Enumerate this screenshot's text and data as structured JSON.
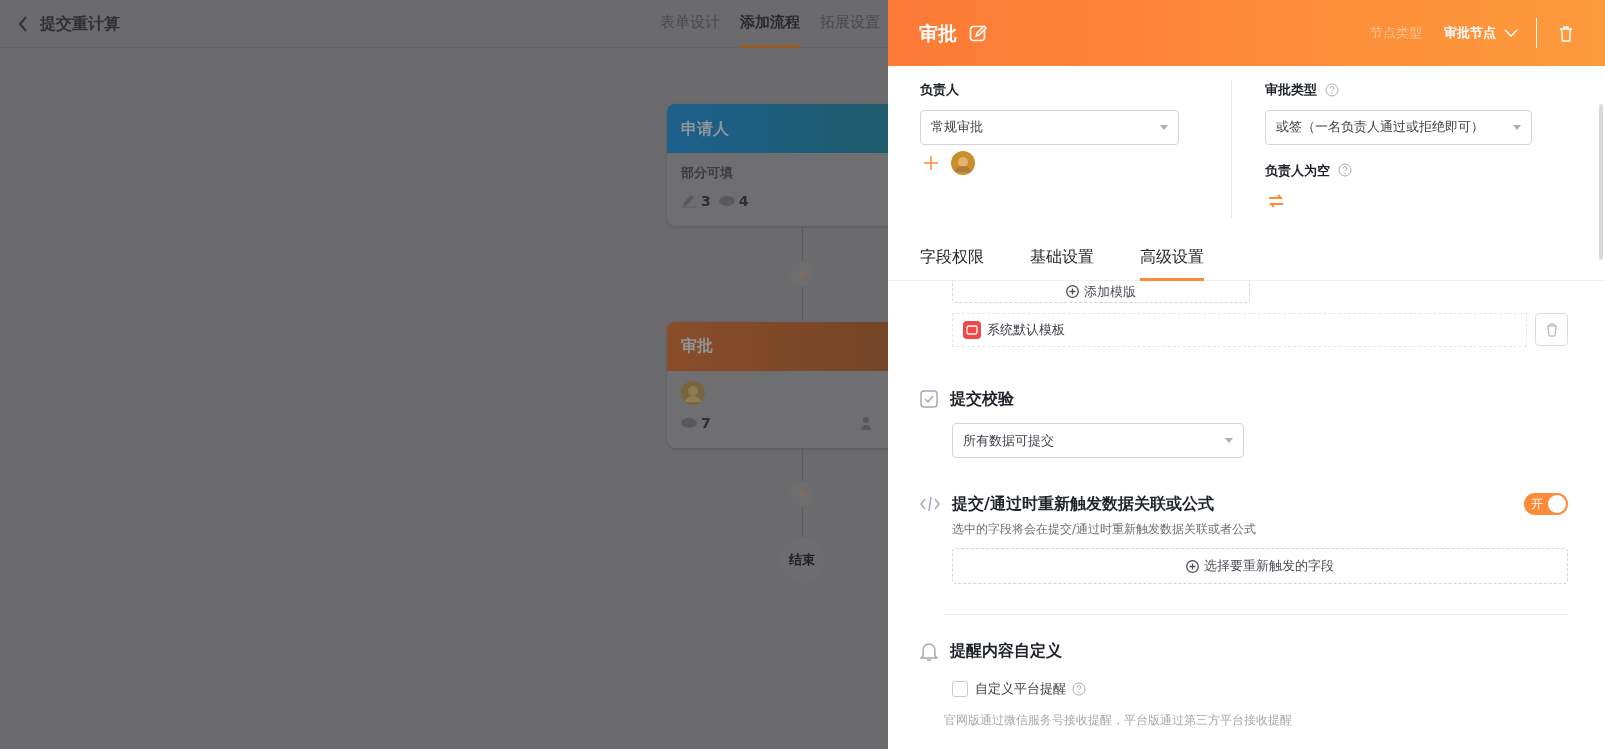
{
  "header": {
    "title": "提交重计算",
    "tabs": [
      {
        "label": "表单设计",
        "selected": false
      },
      {
        "label": "添加流程",
        "selected": true
      },
      {
        "label": "拓展设置",
        "selected": false
      }
    ]
  },
  "flow": {
    "nodes": [
      {
        "kind": "applicant",
        "title": "申请人",
        "subtitle": "部分可填",
        "stats": [
          {
            "kind": "edit",
            "value": "3"
          },
          {
            "kind": "view",
            "value": "4"
          }
        ]
      },
      {
        "kind": "approval",
        "title": "审批",
        "avatar": true,
        "stats": [
          {
            "kind": "view",
            "value": "7"
          }
        ]
      }
    ],
    "end_label": "结束"
  },
  "drawer": {
    "title": "审批",
    "node_type_label": "节点类型",
    "node_type": "审批节点",
    "assignee": {
      "label": "负责人",
      "value": "常规审批"
    },
    "approval_type": {
      "label": "审批类型",
      "value": "或签（一名负责人通过或拒绝即可）"
    },
    "empty_assignee": {
      "label": "负责人为空"
    },
    "tabs": [
      {
        "label": "字段权限",
        "selected": false
      },
      {
        "label": "基础设置",
        "selected": false
      },
      {
        "label": "高级设置",
        "selected": true
      }
    ],
    "template": {
      "add_label": "添加模版",
      "items": [
        {
          "name": "系统默认模板"
        }
      ]
    },
    "sections": [
      {
        "kind": "select",
        "title": "提交校验",
        "value": "所有数据可提交"
      },
      {
        "kind": "toggle",
        "title": "提交/通过时重新触发数据关联或公式",
        "on": true,
        "toggle_label": "开",
        "description": "选中的字段将会在提交/通过时重新触发数据关联或者公式",
        "button": "选择要重新触发的字段"
      },
      {
        "kind": "reminder",
        "title": "提醒内容自定义",
        "option": {
          "label": "自定义平台提醒",
          "checked": false
        },
        "note": "官网版通过微信服务号接收提醒，平台版通过第三方平台接收提醒"
      }
    ]
  }
}
